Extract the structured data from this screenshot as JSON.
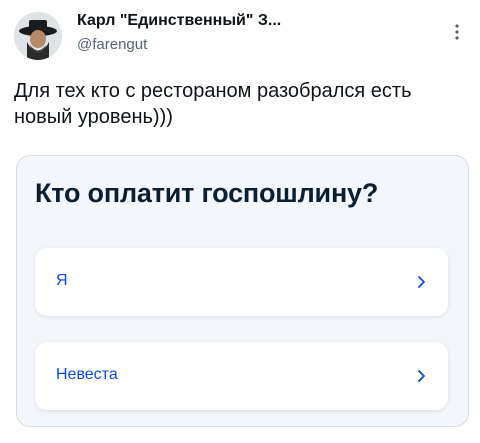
{
  "author": {
    "display_name": "Карл \"Единственный\" З...",
    "handle": "@farengut"
  },
  "tweet": {
    "text": "Для тех кто с рестораном разобрался есть новый уровень)))"
  },
  "media": {
    "question": "Кто оплатит госпошлину?",
    "options": [
      {
        "label": "Я"
      },
      {
        "label": "Невеста"
      }
    ]
  },
  "colors": {
    "link_blue": "#0d4cd3",
    "question_text": "#0b1f33",
    "card_background": "#f3f6fb"
  },
  "icons": {
    "more": "more-vertical-icon",
    "option_arrow": "chevron-right-icon"
  }
}
